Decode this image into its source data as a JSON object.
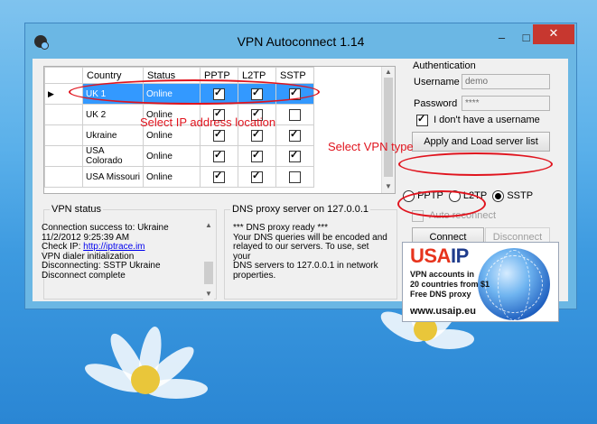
{
  "window": {
    "title": "VPN Autoconnect 1.14",
    "minimize": "–",
    "maximize": "□",
    "close": "✕"
  },
  "server_table": {
    "columns": [
      "Country",
      "Status",
      "PPTP",
      "L2TP",
      "SSTP"
    ],
    "rows": [
      {
        "country": "UK 1",
        "status": "Online",
        "pptp": true,
        "l2tp": true,
        "sstp": true,
        "selected": true
      },
      {
        "country": "UK 2",
        "status": "Online",
        "pptp": true,
        "l2tp": true,
        "sstp": false
      },
      {
        "country": "Ukraine",
        "status": "Online",
        "pptp": true,
        "l2tp": true,
        "sstp": true
      },
      {
        "country": "USA Colorado",
        "status": "Online",
        "pptp": true,
        "l2tp": true,
        "sstp": true
      },
      {
        "country": "USA Missouri",
        "status": "Online",
        "pptp": true,
        "l2tp": true,
        "sstp": false
      }
    ]
  },
  "vpn_status": {
    "title": "VPN status",
    "line1": "Connection success to: Ukraine",
    "line2": "11/2/2012 9:25:39 AM",
    "check_ip_label": "Check IP:",
    "check_ip_link": "http://iptrace.im",
    "line4": "VPN dialer initialization",
    "line5": "Disconnecting: SSTP Ukraine",
    "line6": "Disconnect complete"
  },
  "dns_proxy": {
    "title": "DNS proxy server on 127.0.0.1",
    "line1": "*** DNS proxy ready ***",
    "line2": "Your DNS queries will be encoded and",
    "line3": "relayed to our servers. To use, set your",
    "line4": "DNS servers to 127.0.0.1 in network",
    "line5": "properties."
  },
  "auth": {
    "title": "Authentication",
    "username_label": "Username",
    "username_value": "demo",
    "password_label": "Password",
    "password_value": "****",
    "no_username_label": "I don't have a username",
    "no_username_checked": true,
    "apply_button": "Apply and Load server list"
  },
  "vpn_type": {
    "options": [
      "PPTP",
      "L2TP",
      "SSTP"
    ],
    "selected": "SSTP"
  },
  "auto_reconnect_label": "Auto reconnect",
  "connect_button": "Connect",
  "disconnect_button": "Disconnect",
  "ad": {
    "brand_usa": "USA",
    "brand_ip": "IP",
    "line1": "VPN accounts in",
    "line2": "20 countries from $1",
    "line3": "Free DNS proxy",
    "url": "www.usaip.eu"
  },
  "annotations": {
    "select_ip": "Select IP address location",
    "select_vpn": "Select VPN type"
  },
  "colors": {
    "selection": "#3399ff",
    "annotation": "#e0141e",
    "close_button": "#c7372f"
  }
}
